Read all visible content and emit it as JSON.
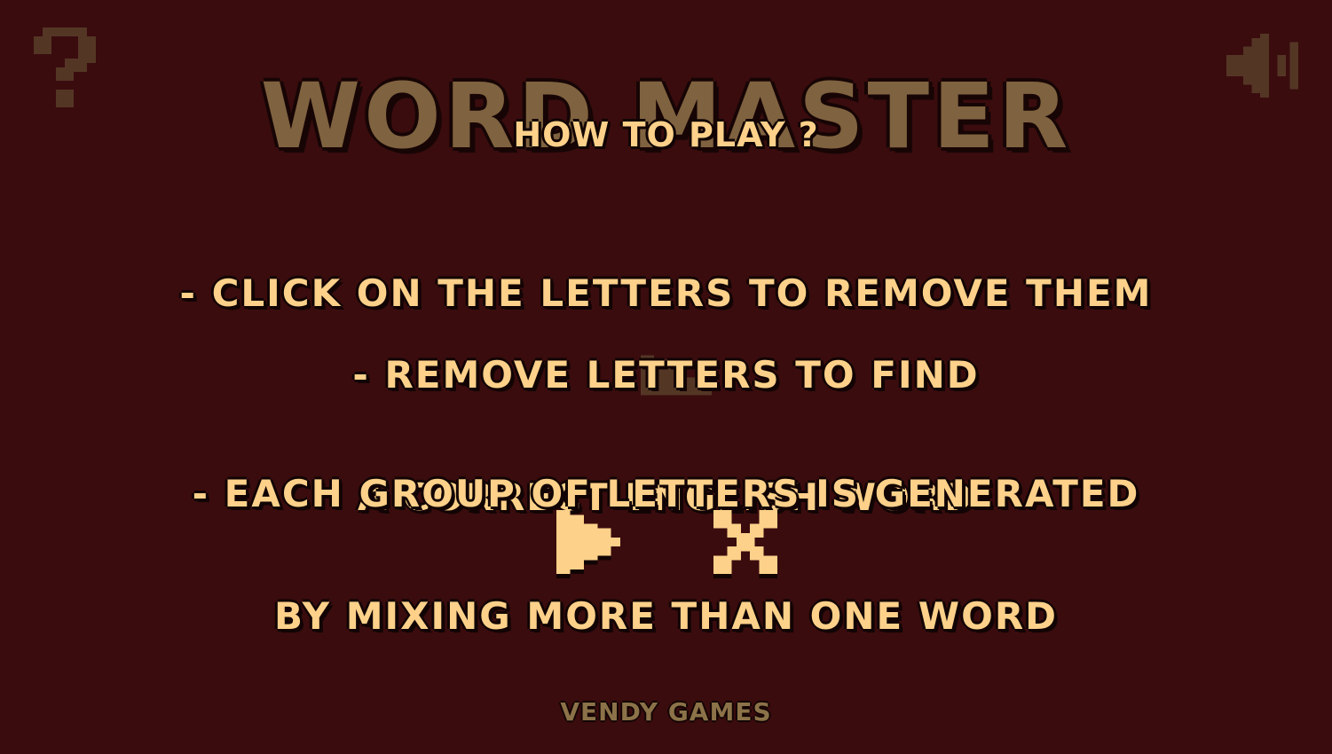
{
  "background": {
    "game_title": "WORD MASTER",
    "help_icon": "question-mark-icon",
    "sound_icon": "speaker-icon",
    "play_icon": "play-icon"
  },
  "dialog": {
    "heading": "HOW TO PLAY ?",
    "instructions": [
      {
        "lines": [
          "- CLICK ON THE LETTERS TO REMOVE THEM"
        ]
      },
      {
        "lines": [
          "- REMOVE LETTERS TO FIND",
          "A CORRECT ENGLISH WORD"
        ]
      },
      {
        "lines": [
          "- EACH GROUP OF LETTERS IS GENERATED",
          "BY MIXING MORE THAN ONE WORD"
        ]
      }
    ],
    "play_button_icon": "play-icon",
    "close_button_icon": "close-icon"
  },
  "footer": {
    "credit": "VENDY GAMES"
  },
  "colors": {
    "background": "#3a0c0e",
    "text": "#fdd18a",
    "dim_text": "#8c7248",
    "outline": "#120404"
  }
}
